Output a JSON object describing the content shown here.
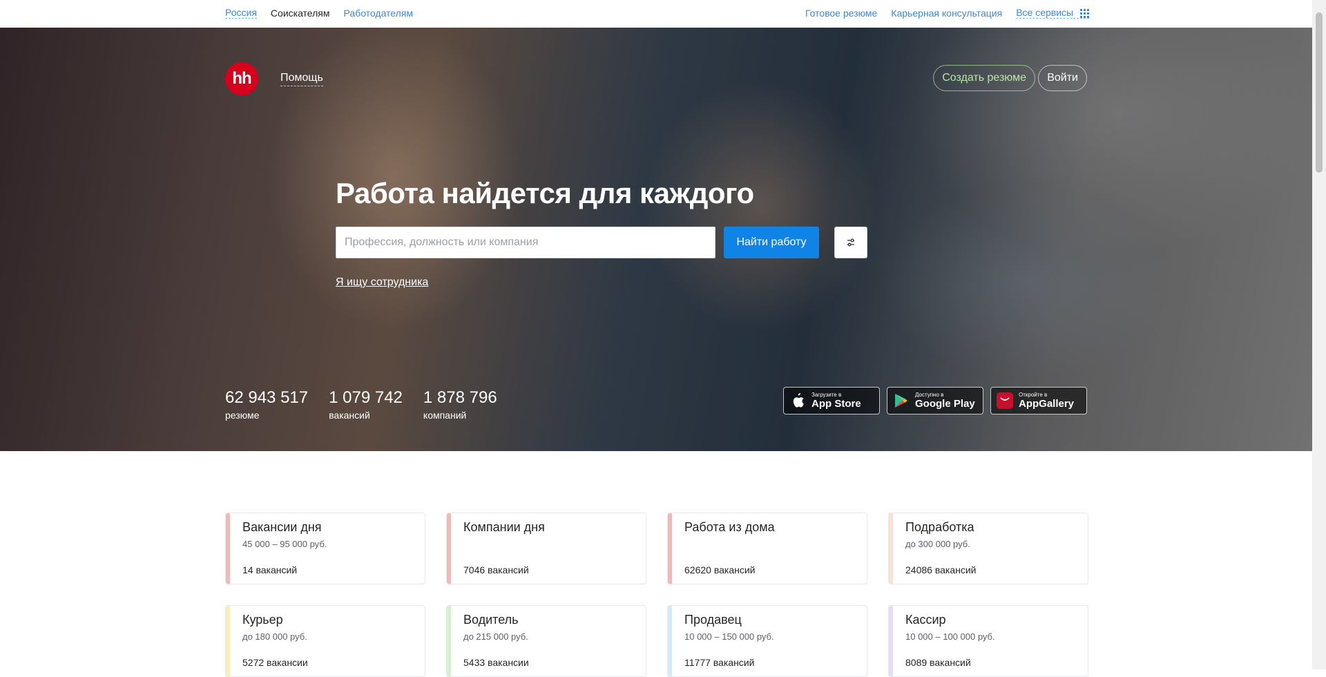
{
  "topbar": {
    "region": "Россия",
    "seekers": "Соискателям",
    "employers": "Работодателям",
    "ready_resume": "Готовое резюме",
    "career_consult": "Карьерная консультация",
    "all_services": "Все сервисы"
  },
  "header": {
    "logo_text": "hh",
    "help": "Помощь",
    "create_resume": "Создать резюме",
    "login": "Войти"
  },
  "hero": {
    "title": "Работа найдется для каждого",
    "search_placeholder": "Профессия, должность или компания",
    "search_button": "Найти работу",
    "employer_link": "Я ищу сотрудника"
  },
  "stats": [
    {
      "value": "62 943 517",
      "label": "резюме"
    },
    {
      "value": "1 079 742",
      "label": "вакансий"
    },
    {
      "value": "1 878 796",
      "label": "компаний"
    }
  ],
  "apps": [
    {
      "small": "Загрузите в",
      "big": "App Store",
      "icon": "apple-icon"
    },
    {
      "small": "Доступно в",
      "big": "Google Play",
      "icon": "google-play-icon"
    },
    {
      "small": "Откройте в",
      "big": "AppGallery",
      "icon": "huawei-icon"
    }
  ],
  "cards": [
    {
      "title": "Вакансии дня",
      "salary": "45 000 – 95 000 руб.",
      "count": "14 вакансий",
      "color": "#f3b7b7"
    },
    {
      "title": "Компании дня",
      "salary": "",
      "count": "7046 вакансий",
      "color": "#f3b7b7"
    },
    {
      "title": "Работа из дома",
      "salary": "",
      "count": "62620 вакансий",
      "color": "#f3b7b7"
    },
    {
      "title": "Подработка",
      "salary": "до 300 000 руб.",
      "count": "24086 вакансий",
      "color": "#fbe1d2"
    },
    {
      "title": "Курьер",
      "salary": "до 180 000 руб.",
      "count": "5272 вакансии",
      "color": "#fbecb8"
    },
    {
      "title": "Водитель",
      "salary": "до 215 000 руб.",
      "count": "5433 вакансии",
      "color": "#d3f0d3"
    },
    {
      "title": "Продавец",
      "salary": "10 000 – 150 000 руб.",
      "count": "11777 вакансий",
      "color": "#d6ebfa"
    },
    {
      "title": "Кассир",
      "salary": "10 000 – 100 000 руб.",
      "count": "8089 вакансий",
      "color": "#e5dcf6"
    }
  ]
}
